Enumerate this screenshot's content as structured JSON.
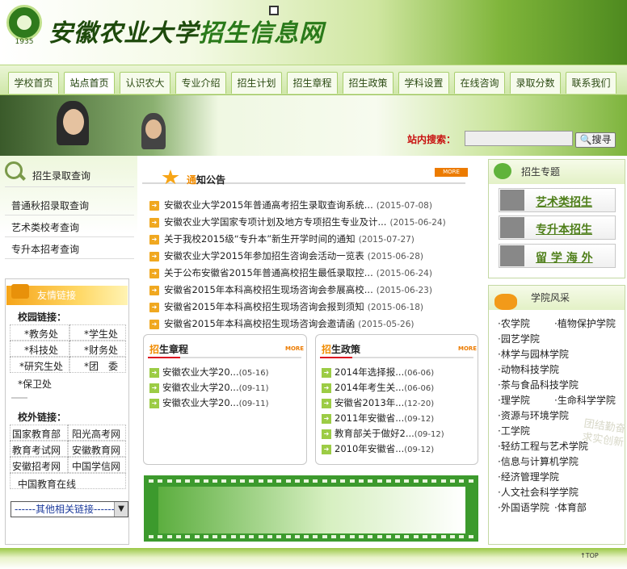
{
  "site": {
    "logo_year": "1935",
    "university": "安徽农业大学",
    "portal": "招生信息网"
  },
  "nav": {
    "tabs": [
      "学校首页",
      "站点首页",
      "认识农大",
      "专业介绍",
      "招生计划",
      "招生章程",
      "招生政策",
      "学科设置",
      "在线咨询",
      "录取分数",
      "联系我们"
    ]
  },
  "search": {
    "label": "站内搜索：",
    "placeholder": "",
    "button": "搜寻"
  },
  "left": {
    "query_title": "招生录取查询",
    "query_items": [
      "普通秋招录取查询",
      "艺术类校考查询",
      "专升本招考查询"
    ],
    "links_title": "友情链接",
    "school_label": "校园链接：",
    "school_links": [
      "*教务处",
      "*学生处",
      "*科技处",
      "*财务处",
      "*研究生处",
      "*团　委",
      "*保卫处"
    ],
    "outer_label": "校外链接：",
    "outer_links": [
      "国家教育部",
      "阳光高考网",
      "教育考试网",
      "安徽教育网",
      "安徽招考网",
      "中国学信网",
      "中国教育在线"
    ],
    "dropdown": "------其他相关链接------"
  },
  "notice": {
    "title_prefix": "通",
    "title_rest": "知公告",
    "more": "MORE",
    "items": [
      {
        "text": "安徽农业大学2015年普通高考招生录取查询系统...",
        "date": "(2015-07-08)"
      },
      {
        "text": "安徽农业大学国家专项计划及地方专项招生专业及计...",
        "date": "(2015-06-24)"
      },
      {
        "text": "关于我校2015级“专升本”新生开学时间的通知",
        "date": "(2015-07-27)"
      },
      {
        "text": "安徽农业大学2015年参加招生咨询会活动一览表",
        "date": "(2015-06-28)"
      },
      {
        "text": "关于公布安徽省2015年普通高校招生最低录取控...",
        "date": "(2015-06-24)"
      },
      {
        "text": "安徽省2015年本科高校招生现场咨询会参展高校...",
        "date": "(2015-06-23)"
      },
      {
        "text": "安徽省2015年本科高校招生现场咨询会报到须知",
        "date": "(2015-06-18)"
      },
      {
        "text": "安徽省2015年本科高校招生现场咨询会邀请函",
        "date": "(2015-05-26)"
      }
    ]
  },
  "charter": {
    "title_prefix": "招",
    "title_rest": "生章程",
    "more": "MORE",
    "items": [
      {
        "text": "安徽农业大学20...",
        "date": "(05-16)"
      },
      {
        "text": "安徽农业大学20...",
        "date": "(09-11)"
      },
      {
        "text": "安徽农业大学20...",
        "date": "(09-11)"
      }
    ]
  },
  "policy": {
    "title_prefix": "招",
    "title_rest": "生政策",
    "more": "MORE",
    "items": [
      {
        "text": "2014年选择报...",
        "date": "(06-06)"
      },
      {
        "text": "2014年考生关...",
        "date": "(06-06)"
      },
      {
        "text": "安徽省2013年...",
        "date": "(12-20)"
      },
      {
        "text": "2011年安徽省...",
        "date": "(09-12)"
      },
      {
        "text": "教育部关于做好2...",
        "date": "(09-12)"
      },
      {
        "text": "2010年安徽省...",
        "date": "(09-12)"
      }
    ]
  },
  "special": {
    "title": "招生专题",
    "items": [
      "艺术类招生",
      "专升本招生",
      "留 学 海 外"
    ]
  },
  "colleges": {
    "title": "学院风采",
    "left": [
      "·农学院",
      "·园艺学院",
      "·林学与园林学院",
      "·动物科技学院",
      "·茶与食品科技学院",
      "·理学院",
      "·资源与环境学院",
      "·工学院",
      "·轻纺工程与艺术学院",
      "·信息与计算机学院",
      "·经济管理学院",
      "·人文社会科学学院",
      "·外国语学院"
    ],
    "right": [
      "·植物保护学院",
      "·生命科学学院",
      "·体育部"
    ],
    "stamp": "团结勤奋求实创新"
  },
  "footer": {
    "top": "↑TOP"
  }
}
